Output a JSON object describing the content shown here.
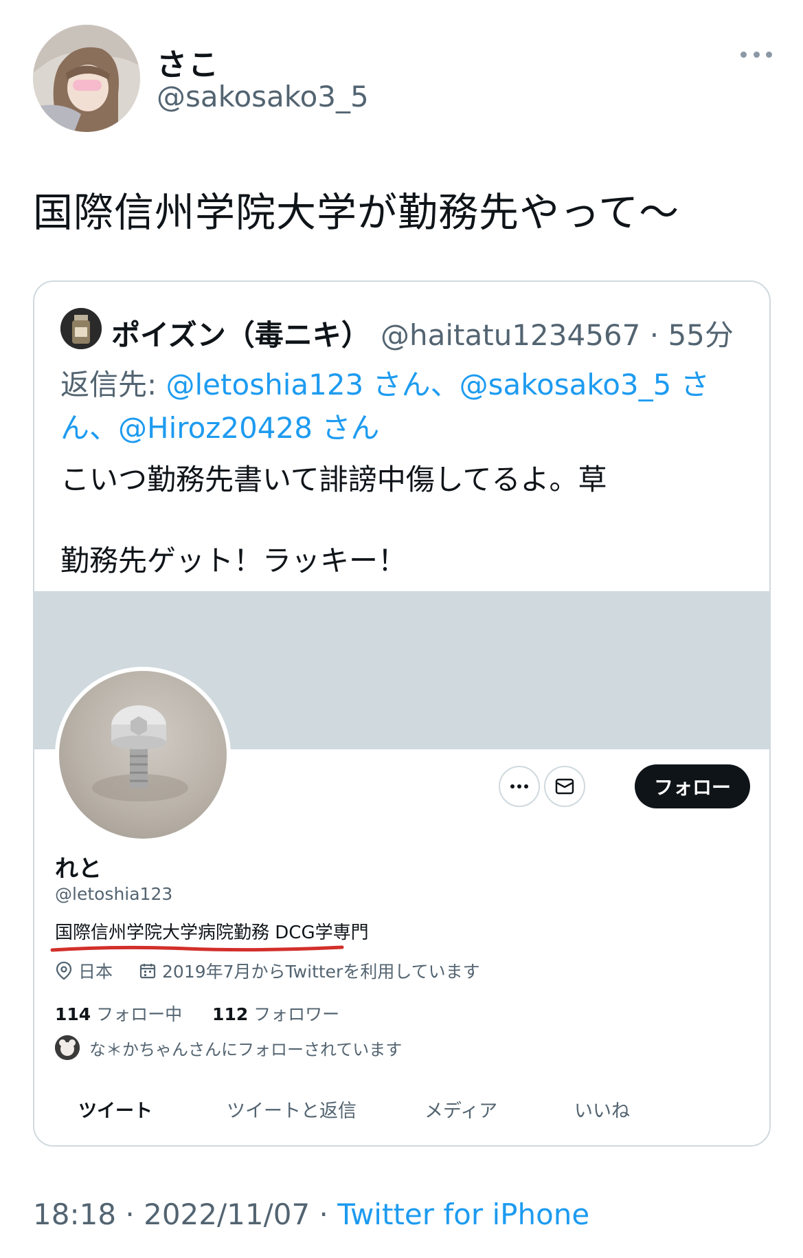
{
  "author": {
    "display_name": "さこ",
    "handle": "@sakosako3_5"
  },
  "tweet": {
    "text": "国際信州学院大学が勤務先やって〜",
    "time": "18:18",
    "sep1": " · ",
    "date": "2022/11/07",
    "sep2": " · ",
    "source": "Twitter for iPhone"
  },
  "quoted": {
    "display_name": "ポイズン（毒ニキ）",
    "handle": "@haitatu1234567",
    "dot": " · ",
    "age": "55分",
    "reply_prefix": "返信先: ",
    "reply_m1": "@letoshia123",
    "reply_s1": " さん、",
    "reply_m2": "@sakosako3_5",
    "reply_s2": " さん、",
    "reply_m3": "@Hiroz20428",
    "reply_s3": " さん",
    "line1": "こいつ勤務先書いて誹謗中傷してるよ。草",
    "line2": "勤務先ゲット！ラッキー！"
  },
  "profile": {
    "name": "れと",
    "handle": "@letoshia123",
    "bio": "国際信州学院大学病院勤務 DCG学専門",
    "location": "日本",
    "joined": "2019年7月からTwitterを利用しています",
    "following_count": "114",
    "following_label": " フォロー中",
    "followers_count": "112",
    "followers_label": " フォロワー",
    "followed_by": "な＊かちゃんさんにフォローされています",
    "follow_button": "フォロー",
    "tabs": [
      "ツイート",
      "ツイートと返信",
      "メディア",
      "いいね"
    ]
  },
  "colors": {
    "link": "#1d9bf0",
    "muted": "#536471",
    "banner": "#cfd9de",
    "annotation": "#d22f2a"
  }
}
